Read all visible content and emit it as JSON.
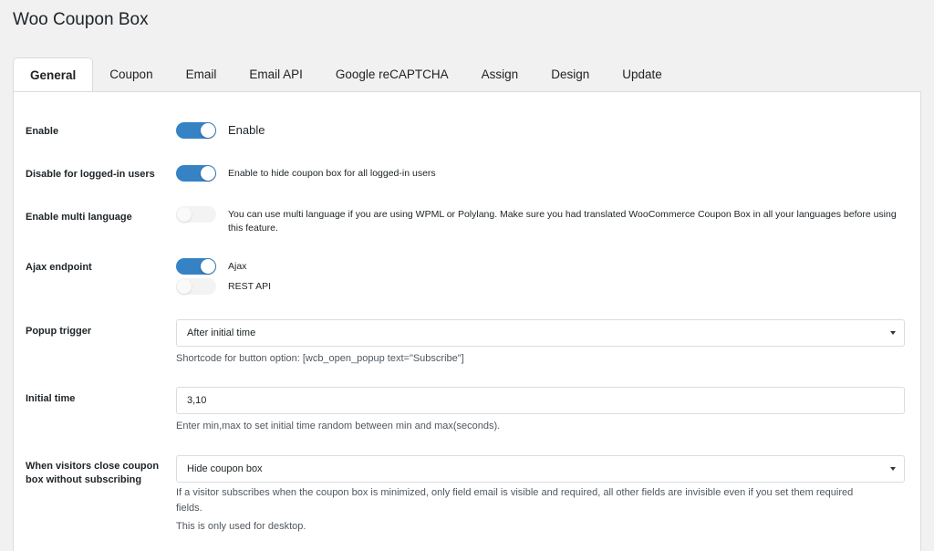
{
  "page_title": "Woo Coupon Box",
  "tabs": [
    "General",
    "Coupon",
    "Email",
    "Email API",
    "Google reCAPTCHA",
    "Assign",
    "Design",
    "Update"
  ],
  "active_tab": "General",
  "settings": {
    "enable": {
      "label": "Enable",
      "toggle_on": true,
      "description": "Enable"
    },
    "disable_logged_in": {
      "label": "Disable for logged-in users",
      "toggle_on": true,
      "description": "Enable to hide coupon box for all logged-in users"
    },
    "multi_language": {
      "label": "Enable multi language",
      "toggle_on": false,
      "description_line1": "You can use multi language if you are using WPML or Polylang. Make sure you had translated WooCommerce Coupon Box in all your languages before using",
      "description_line2": "this feature."
    },
    "ajax_endpoint": {
      "label": "Ajax endpoint",
      "option_ajax": "Ajax",
      "ajax_on": true,
      "option_rest": "REST API",
      "rest_on": false
    },
    "popup_trigger": {
      "label": "Popup trigger",
      "value": "After initial time",
      "help": "Shortcode for button option: [wcb_open_popup text=\"Subscribe\"]"
    },
    "initial_time": {
      "label": "Initial time",
      "value": "3,10",
      "help": "Enter min,max to set initial time random between min and max(seconds)."
    },
    "close_behavior": {
      "label_line1": "When visitors close coupon",
      "label_line2": "box without subscribing",
      "value": "Hide coupon box",
      "help_line1": "If a visitor subscribes when the coupon box is minimized, only field email is visible and required, all other fields are invisible even if you set them required",
      "help_line2": "fields.",
      "help_line3": "This is only used for desktop."
    }
  },
  "colors": {
    "toggle_on": "#3582c4",
    "toggle_off": "#f3f3f3",
    "background": "#f1f1f1",
    "panel": "#ffffff"
  }
}
